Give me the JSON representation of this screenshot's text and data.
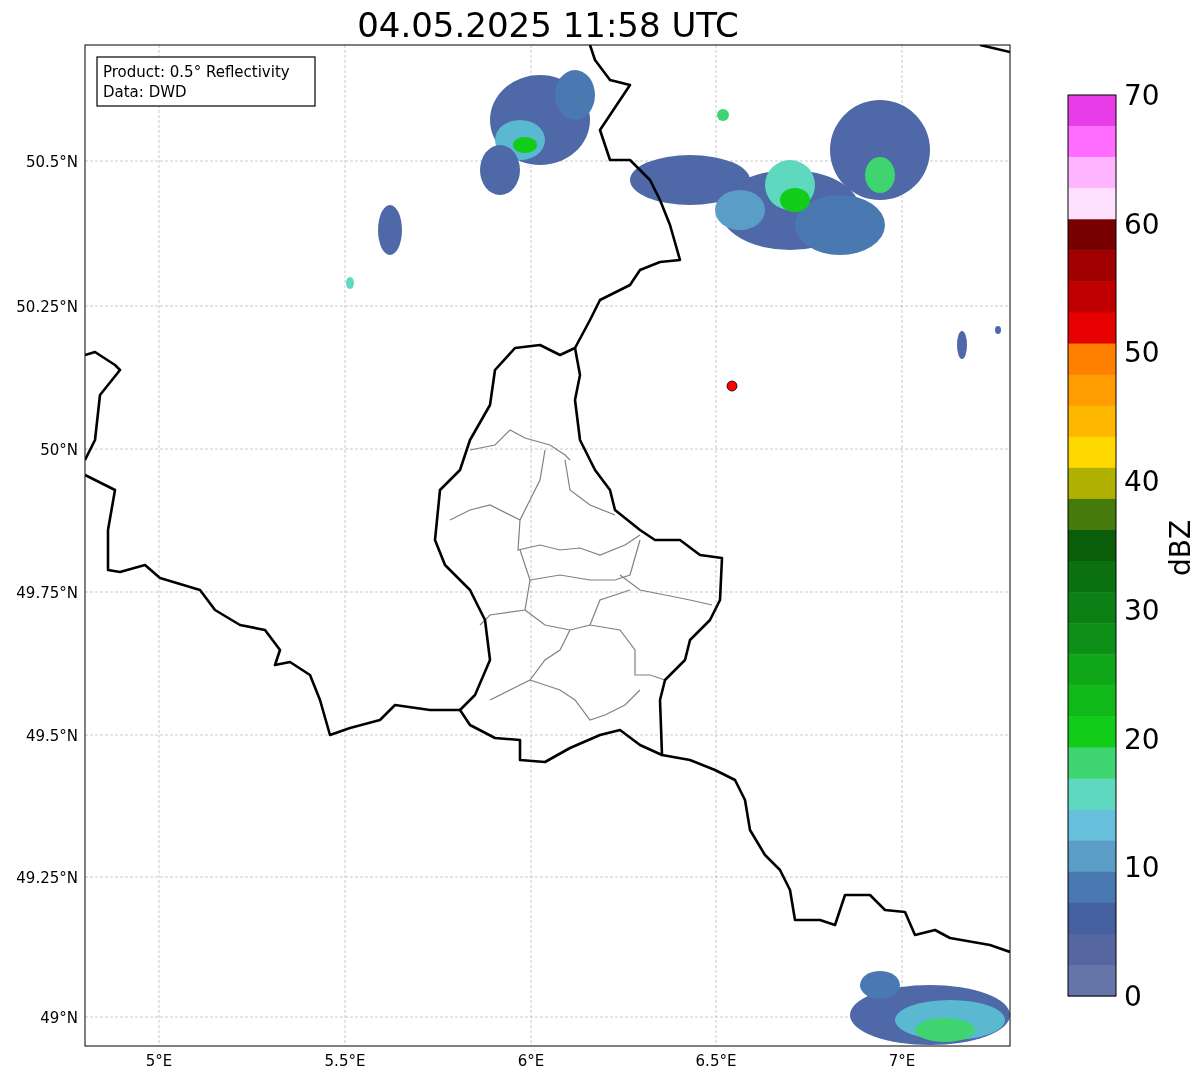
{
  "title": "04.05.2025 11:58 UTC",
  "legend": [
    "Product: 0.5° Reflectivity",
    "Data: DWD"
  ],
  "x_ticks": [
    "5°E",
    "5.5°E",
    "6°E",
    "6.5°E",
    "7°E"
  ],
  "y_ticks": [
    "50.5°N",
    "50.25°N",
    "50°N",
    "49.75°N",
    "49.5°N",
    "49.25°N",
    "49°N"
  ],
  "colorbar": {
    "label": "dBZ",
    "ticks": [
      "70",
      "60",
      "50",
      "40",
      "30",
      "20",
      "10",
      "0"
    ],
    "bins": [
      {
        "color": "#e83ce8"
      },
      {
        "color": "#ff6cff"
      },
      {
        "color": "#ffb4ff"
      },
      {
        "color": "#ffe0ff"
      },
      {
        "color": "#780000"
      },
      {
        "color": "#a00000"
      },
      {
        "color": "#c00000"
      },
      {
        "color": "#e60000"
      },
      {
        "color": "#ff7f00"
      },
      {
        "color": "#ff9c00"
      },
      {
        "color": "#ffb800"
      },
      {
        "color": "#ffd800"
      },
      {
        "color": "#b0b000"
      },
      {
        "color": "#467a0a"
      },
      {
        "color": "#0a5e0a"
      },
      {
        "color": "#0a7010"
      },
      {
        "color": "#0c8014"
      },
      {
        "color": "#0e9018"
      },
      {
        "color": "#10a818"
      },
      {
        "color": "#10b818"
      },
      {
        "color": "#12cc1a"
      },
      {
        "color": "#3ed470"
      },
      {
        "color": "#5fd8c0"
      },
      {
        "color": "#66c0dc"
      },
      {
        "color": "#5a9ec8"
      },
      {
        "color": "#4a78b0"
      },
      {
        "color": "#4560a0"
      },
      {
        "color": "#5566a0"
      },
      {
        "color": "#6675a8"
      }
    ]
  }
}
